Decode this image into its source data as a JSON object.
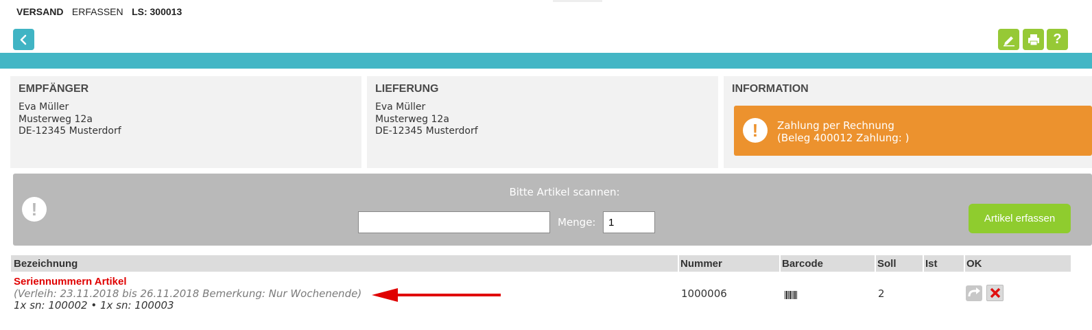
{
  "header": {
    "section": "VERSAND",
    "action": "ERFASSEN",
    "ls_label": "LS: 300013"
  },
  "toolbar": {
    "back_icon": "chevron-left-icon",
    "edit_icon": "pencil-icon",
    "print_icon": "printer-icon",
    "help_label": "?",
    "accent_teal": "#43b6c5",
    "accent_green": "#96c936"
  },
  "recipient": {
    "title": "EMPFÄNGER",
    "line1": "Eva Müller",
    "line2": "Musterweg 12a",
    "line3": "DE-12345 Musterdorf"
  },
  "delivery": {
    "title": "LIEFERUNG",
    "line1": "Eva Müller",
    "line2": "Musterweg 12a",
    "line3": "DE-12345 Musterdorf"
  },
  "information": {
    "title": "INFORMATION",
    "alert_icon": "!",
    "alert_line1": "Zahlung per Rechnung",
    "alert_line2": "(Beleg 400012 Zahlung: )",
    "alert_color": "#ec922e"
  },
  "scan": {
    "warning_icon": "!",
    "prompt": "Bitte Artikel scannen:",
    "scan_value": "",
    "menge_label": "Menge:",
    "menge_value": "1",
    "submit_label": "Artikel erfassen"
  },
  "table": {
    "headers": {
      "bezeichnung": "Bezeichnung",
      "nummer": "Nummer",
      "barcode": "Barcode",
      "soll": "Soll",
      "ist": "Ist",
      "ok": "OK"
    },
    "rows": [
      {
        "name": "Seriennummern Artikel",
        "remark": "(Verleih: 23.11.2018 bis 26.11.2018 Bemerkung: Nur Wochenende)",
        "serials": "1x sn: 100002 • 1x sn: 100003",
        "nummer": "1000006",
        "barcode_icon": "barcode-icon",
        "soll": "2",
        "ist": ""
      }
    ]
  }
}
